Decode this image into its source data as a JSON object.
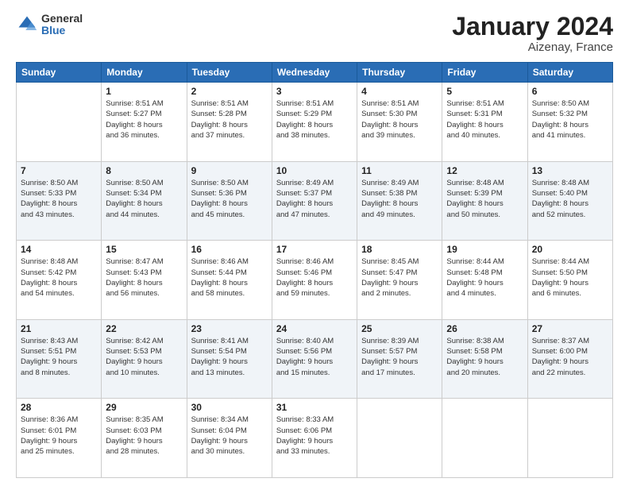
{
  "logo": {
    "general": "General",
    "blue": "Blue"
  },
  "header": {
    "title": "January 2024",
    "subtitle": "Aizenay, France"
  },
  "columns": [
    "Sunday",
    "Monday",
    "Tuesday",
    "Wednesday",
    "Thursday",
    "Friday",
    "Saturday"
  ],
  "weeks": [
    [
      {
        "day": "",
        "sunrise": "",
        "sunset": "",
        "daylight": ""
      },
      {
        "day": "1",
        "sunrise": "Sunrise: 8:51 AM",
        "sunset": "Sunset: 5:27 PM",
        "daylight": "Daylight: 8 hours and 36 minutes."
      },
      {
        "day": "2",
        "sunrise": "Sunrise: 8:51 AM",
        "sunset": "Sunset: 5:28 PM",
        "daylight": "Daylight: 8 hours and 37 minutes."
      },
      {
        "day": "3",
        "sunrise": "Sunrise: 8:51 AM",
        "sunset": "Sunset: 5:29 PM",
        "daylight": "Daylight: 8 hours and 38 minutes."
      },
      {
        "day": "4",
        "sunrise": "Sunrise: 8:51 AM",
        "sunset": "Sunset: 5:30 PM",
        "daylight": "Daylight: 8 hours and 39 minutes."
      },
      {
        "day": "5",
        "sunrise": "Sunrise: 8:51 AM",
        "sunset": "Sunset: 5:31 PM",
        "daylight": "Daylight: 8 hours and 40 minutes."
      },
      {
        "day": "6",
        "sunrise": "Sunrise: 8:50 AM",
        "sunset": "Sunset: 5:32 PM",
        "daylight": "Daylight: 8 hours and 41 minutes."
      }
    ],
    [
      {
        "day": "7",
        "sunrise": "Sunrise: 8:50 AM",
        "sunset": "Sunset: 5:33 PM",
        "daylight": "Daylight: 8 hours and 43 minutes."
      },
      {
        "day": "8",
        "sunrise": "Sunrise: 8:50 AM",
        "sunset": "Sunset: 5:34 PM",
        "daylight": "Daylight: 8 hours and 44 minutes."
      },
      {
        "day": "9",
        "sunrise": "Sunrise: 8:50 AM",
        "sunset": "Sunset: 5:36 PM",
        "daylight": "Daylight: 8 hours and 45 minutes."
      },
      {
        "day": "10",
        "sunrise": "Sunrise: 8:49 AM",
        "sunset": "Sunset: 5:37 PM",
        "daylight": "Daylight: 8 hours and 47 minutes."
      },
      {
        "day": "11",
        "sunrise": "Sunrise: 8:49 AM",
        "sunset": "Sunset: 5:38 PM",
        "daylight": "Daylight: 8 hours and 49 minutes."
      },
      {
        "day": "12",
        "sunrise": "Sunrise: 8:48 AM",
        "sunset": "Sunset: 5:39 PM",
        "daylight": "Daylight: 8 hours and 50 minutes."
      },
      {
        "day": "13",
        "sunrise": "Sunrise: 8:48 AM",
        "sunset": "Sunset: 5:40 PM",
        "daylight": "Daylight: 8 hours and 52 minutes."
      }
    ],
    [
      {
        "day": "14",
        "sunrise": "Sunrise: 8:48 AM",
        "sunset": "Sunset: 5:42 PM",
        "daylight": "Daylight: 8 hours and 54 minutes."
      },
      {
        "day": "15",
        "sunrise": "Sunrise: 8:47 AM",
        "sunset": "Sunset: 5:43 PM",
        "daylight": "Daylight: 8 hours and 56 minutes."
      },
      {
        "day": "16",
        "sunrise": "Sunrise: 8:46 AM",
        "sunset": "Sunset: 5:44 PM",
        "daylight": "Daylight: 8 hours and 58 minutes."
      },
      {
        "day": "17",
        "sunrise": "Sunrise: 8:46 AM",
        "sunset": "Sunset: 5:46 PM",
        "daylight": "Daylight: 8 hours and 59 minutes."
      },
      {
        "day": "18",
        "sunrise": "Sunrise: 8:45 AM",
        "sunset": "Sunset: 5:47 PM",
        "daylight": "Daylight: 9 hours and 2 minutes."
      },
      {
        "day": "19",
        "sunrise": "Sunrise: 8:44 AM",
        "sunset": "Sunset: 5:48 PM",
        "daylight": "Daylight: 9 hours and 4 minutes."
      },
      {
        "day": "20",
        "sunrise": "Sunrise: 8:44 AM",
        "sunset": "Sunset: 5:50 PM",
        "daylight": "Daylight: 9 hours and 6 minutes."
      }
    ],
    [
      {
        "day": "21",
        "sunrise": "Sunrise: 8:43 AM",
        "sunset": "Sunset: 5:51 PM",
        "daylight": "Daylight: 9 hours and 8 minutes."
      },
      {
        "day": "22",
        "sunrise": "Sunrise: 8:42 AM",
        "sunset": "Sunset: 5:53 PM",
        "daylight": "Daylight: 9 hours and 10 minutes."
      },
      {
        "day": "23",
        "sunrise": "Sunrise: 8:41 AM",
        "sunset": "Sunset: 5:54 PM",
        "daylight": "Daylight: 9 hours and 13 minutes."
      },
      {
        "day": "24",
        "sunrise": "Sunrise: 8:40 AM",
        "sunset": "Sunset: 5:56 PM",
        "daylight": "Daylight: 9 hours and 15 minutes."
      },
      {
        "day": "25",
        "sunrise": "Sunrise: 8:39 AM",
        "sunset": "Sunset: 5:57 PM",
        "daylight": "Daylight: 9 hours and 17 minutes."
      },
      {
        "day": "26",
        "sunrise": "Sunrise: 8:38 AM",
        "sunset": "Sunset: 5:58 PM",
        "daylight": "Daylight: 9 hours and 20 minutes."
      },
      {
        "day": "27",
        "sunrise": "Sunrise: 8:37 AM",
        "sunset": "Sunset: 6:00 PM",
        "daylight": "Daylight: 9 hours and 22 minutes."
      }
    ],
    [
      {
        "day": "28",
        "sunrise": "Sunrise: 8:36 AM",
        "sunset": "Sunset: 6:01 PM",
        "daylight": "Daylight: 9 hours and 25 minutes."
      },
      {
        "day": "29",
        "sunrise": "Sunrise: 8:35 AM",
        "sunset": "Sunset: 6:03 PM",
        "daylight": "Daylight: 9 hours and 28 minutes."
      },
      {
        "day": "30",
        "sunrise": "Sunrise: 8:34 AM",
        "sunset": "Sunset: 6:04 PM",
        "daylight": "Daylight: 9 hours and 30 minutes."
      },
      {
        "day": "31",
        "sunrise": "Sunrise: 8:33 AM",
        "sunset": "Sunset: 6:06 PM",
        "daylight": "Daylight: 9 hours and 33 minutes."
      },
      {
        "day": "",
        "sunrise": "",
        "sunset": "",
        "daylight": ""
      },
      {
        "day": "",
        "sunrise": "",
        "sunset": "",
        "daylight": ""
      },
      {
        "day": "",
        "sunrise": "",
        "sunset": "",
        "daylight": ""
      }
    ]
  ]
}
